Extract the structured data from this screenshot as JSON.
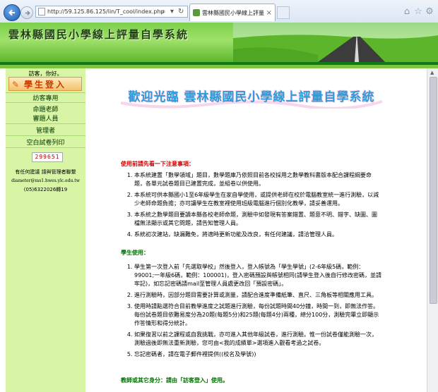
{
  "browser": {
    "url": "http://59.125.86.125/lin/T_cool/index.php",
    "tab_title": "雲林縣國民小學線上評量自...",
    "icons": {
      "back": "arrow-left-icon",
      "forward": "arrow-right-icon",
      "home": "home-icon",
      "favorites": "star-icon",
      "settings": "gear-icon"
    }
  },
  "banner": {
    "title": "雲林縣國民小學線上評量自學系統"
  },
  "sidebar": {
    "welcome": "訪客，你好。",
    "login_label": "學生登入",
    "items": [
      {
        "lines": [
          "訪客專用"
        ]
      },
      {
        "lines": [
          "命題老師",
          "審題人員"
        ]
      },
      {
        "lines": [
          "管理者"
        ]
      },
      {
        "lines": [
          "空白試卷列印"
        ]
      }
    ],
    "counter": "299651",
    "contact_title": "有任何建議 請與管理者聯繫",
    "contact_email": "diameter@ms1.hwes.ylc.edu.tw",
    "contact_phone": "(05)6322026轉19"
  },
  "main": {
    "welcome_banner": "歡迎光臨 雲林縣國民小學線上評量自學系統",
    "notice_heading": "使用前請先看一下注意事項：",
    "notice_items": [
      "本系統建置「數學領域」題目，數學題庫乃依照目前各校採用之數學教科書版本配合課程綱要命題，各單元試卷題目已建置完成，並組卷以供使用。",
      "本系統可供本縣國小1至6年級學生在家自學使用，或提供老師在校於電腦教室統一進行測驗，以減少老師命題負擔；亦可讓學生在教室裡使用班級電腦進行個別化教學，請妥善運用。",
      "本系統之數學題目要讀本縣各校老師命題，測驗中如發現有答案錯置、題意不明、錯字、缺圖、圖檔無法顯示或其它問題，請告知管理人員。",
      "系統初次建站，缺漏難免，將適時更新功能及改良，有任何建議，請洽管理人員。"
    ],
    "student_heading": "學生使用：",
    "student_items": [
      "學生第一次登入前「先選取學校」然後登入，登入帳號為「學生學號」(2-6年級5碼，範例：99001;一年級6碼，範例：100001)，登入密碼預設與帳號相同(請學生登入後自行修改密碼，並請牢記)，如忘記密碼請mail至管理人員處更改回「預設密碼」。",
      "進行測驗時，因部分題目需要計算或測量，請配合進度準備紙筆、直尺、三角板等相關應用工具。",
      "使用時請點選符合目前教學進度之試題進行測驗，每份試題時間40分鐘，時間一到，即無法作答。每份試卷題目依難易度分為20題(每題5分)和25題(每題4分)兩種，總分100分，測驗完畢立即顯示作答情形和得分統計。",
      "如果復習以前之課程或自我挑戰，亦可進入其他年級試卷，進行測驗。惟一份試卷僅能測驗一次，測驗過後即無法重新測驗，您可由<我的成績單>選項進入觀看考過之試卷。",
      "忘記密碼者，請在電子郵件裡提供((校名及學號))"
    ],
    "teacher_heading": "教師或其它身分：請由「訪客登入」使用。"
  },
  "colors": {
    "banner_green": "#7ed04d",
    "sidebar_bg": "#d7f5a4",
    "dark_bar": "#0e7a16",
    "notice_red": "#d00000",
    "heading_green": "#007000"
  }
}
